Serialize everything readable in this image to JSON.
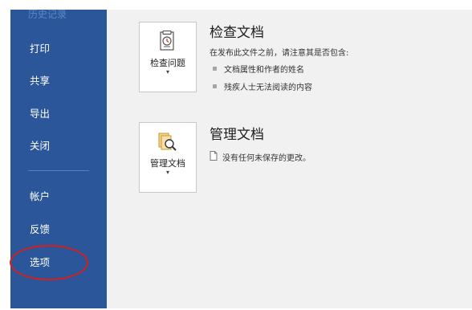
{
  "sidebar": {
    "faded_item": "历史记录",
    "items": [
      {
        "label": "打印"
      },
      {
        "label": "共享"
      },
      {
        "label": "导出"
      },
      {
        "label": "关闭"
      },
      {
        "label": "帐户"
      },
      {
        "label": "反馈"
      },
      {
        "label": "选项"
      }
    ]
  },
  "inspect": {
    "button_label": "检查问题",
    "title": "检查文档",
    "subtitle": "在发布此文件之前，请注意其是否包含:",
    "bullets": [
      "文档属性和作者的姓名",
      "残疾人士无法阅读的内容"
    ]
  },
  "manage": {
    "button_label": "管理文档",
    "title": "管理文档",
    "note": "没有任何未保存的更改。"
  },
  "colors": {
    "sidebar_bg": "#2b579a",
    "highlight": "#d81e1e",
    "content_bg": "#f1f1f1"
  }
}
